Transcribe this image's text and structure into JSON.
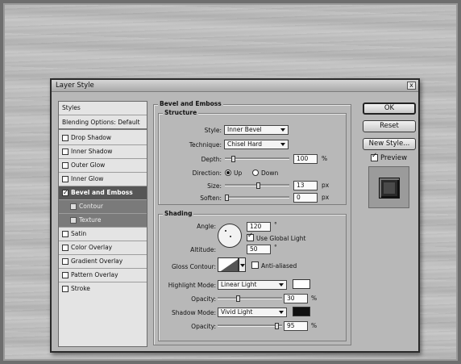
{
  "dialog": {
    "title": "Layer Style",
    "close_glyph": "x"
  },
  "styles_list": {
    "items": [
      {
        "label": "Styles",
        "type": "header"
      },
      {
        "label": "Blending Options: Default",
        "type": "header"
      },
      {
        "label": "Drop Shadow",
        "checked": false
      },
      {
        "label": "Inner Shadow",
        "checked": false
      },
      {
        "label": "Outer Glow",
        "checked": false
      },
      {
        "label": "Inner Glow",
        "checked": false
      },
      {
        "label": "Bevel and Emboss",
        "checked": true,
        "selected": true
      },
      {
        "label": "Contour",
        "checked": false,
        "sub": true
      },
      {
        "label": "Texture",
        "checked": false,
        "sub": true
      },
      {
        "label": "Satin",
        "checked": false
      },
      {
        "label": "Color Overlay",
        "checked": false
      },
      {
        "label": "Gradient Overlay",
        "checked": false
      },
      {
        "label": "Pattern Overlay",
        "checked": false
      },
      {
        "label": "Stroke",
        "checked": false
      }
    ]
  },
  "bevel": {
    "section_title": "Bevel and Emboss",
    "structure": {
      "title": "Structure",
      "style_label": "Style:",
      "style_value": "Inner Bevel",
      "technique_label": "Technique:",
      "technique_value": "Chisel Hard",
      "depth_label": "Depth:",
      "depth_value": "100",
      "depth_unit": "%",
      "depth_slider_fraction": 0.1,
      "direction_label": "Direction:",
      "direction_up": "Up",
      "direction_down": "Down",
      "direction_selected": "Up",
      "size_label": "Size:",
      "size_value": "13",
      "size_unit": "px",
      "size_slider_fraction": 0.52,
      "soften_label": "Soften:",
      "soften_value": "0",
      "soften_unit": "px",
      "soften_slider_fraction": 0.0
    },
    "shading": {
      "title": "Shading",
      "angle_label": "Angle:",
      "angle_value": "120",
      "angle_unit": "°",
      "use_global_light_label": "Use Global Light",
      "use_global_light": true,
      "altitude_label": "Altitude:",
      "altitude_value": "50",
      "altitude_unit": "°",
      "gloss_contour_label": "Gloss Contour:",
      "anti_aliased_label": "Anti-aliased",
      "anti_aliased": false,
      "highlight_mode_label": "Highlight Mode:",
      "highlight_mode_value": "Linear Light",
      "highlight_color": "#ffffff",
      "highlight_opacity_label": "Opacity:",
      "highlight_opacity_value": "30",
      "highlight_opacity_unit": "%",
      "highlight_opacity_fraction": 0.3,
      "shadow_mode_label": "Shadow Mode:",
      "shadow_mode_value": "Vivid Light",
      "shadow_color": "#111111",
      "shadow_opacity_label": "Opacity:",
      "shadow_opacity_value": "95",
      "shadow_opacity_unit": "%",
      "shadow_opacity_fraction": 0.95
    }
  },
  "buttons": {
    "ok": "OK",
    "reset": "Reset",
    "new_style": "New Style...",
    "preview_label": "Preview",
    "preview_checked": true
  }
}
